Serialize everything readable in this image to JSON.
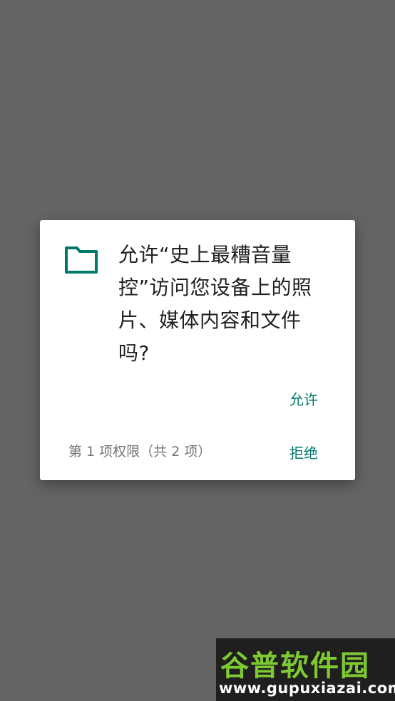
{
  "dialog": {
    "icon": "folder-icon",
    "message": "允许“史上最糟音量控”访问您设备上的照片、媒体内容和文件吗?",
    "allow_label": "允许",
    "counter": "第 1 项权限（共 2 项）",
    "deny_label": "拒绝"
  },
  "watermark": {
    "logo": "谷普软件园",
    "url": "www.gupuxiazai.com"
  },
  "colors": {
    "scrim": "#646464",
    "accent": "#00796b",
    "dialog_bg": "#ffffff",
    "text_primary": "#212121",
    "text_secondary": "#757575"
  }
}
